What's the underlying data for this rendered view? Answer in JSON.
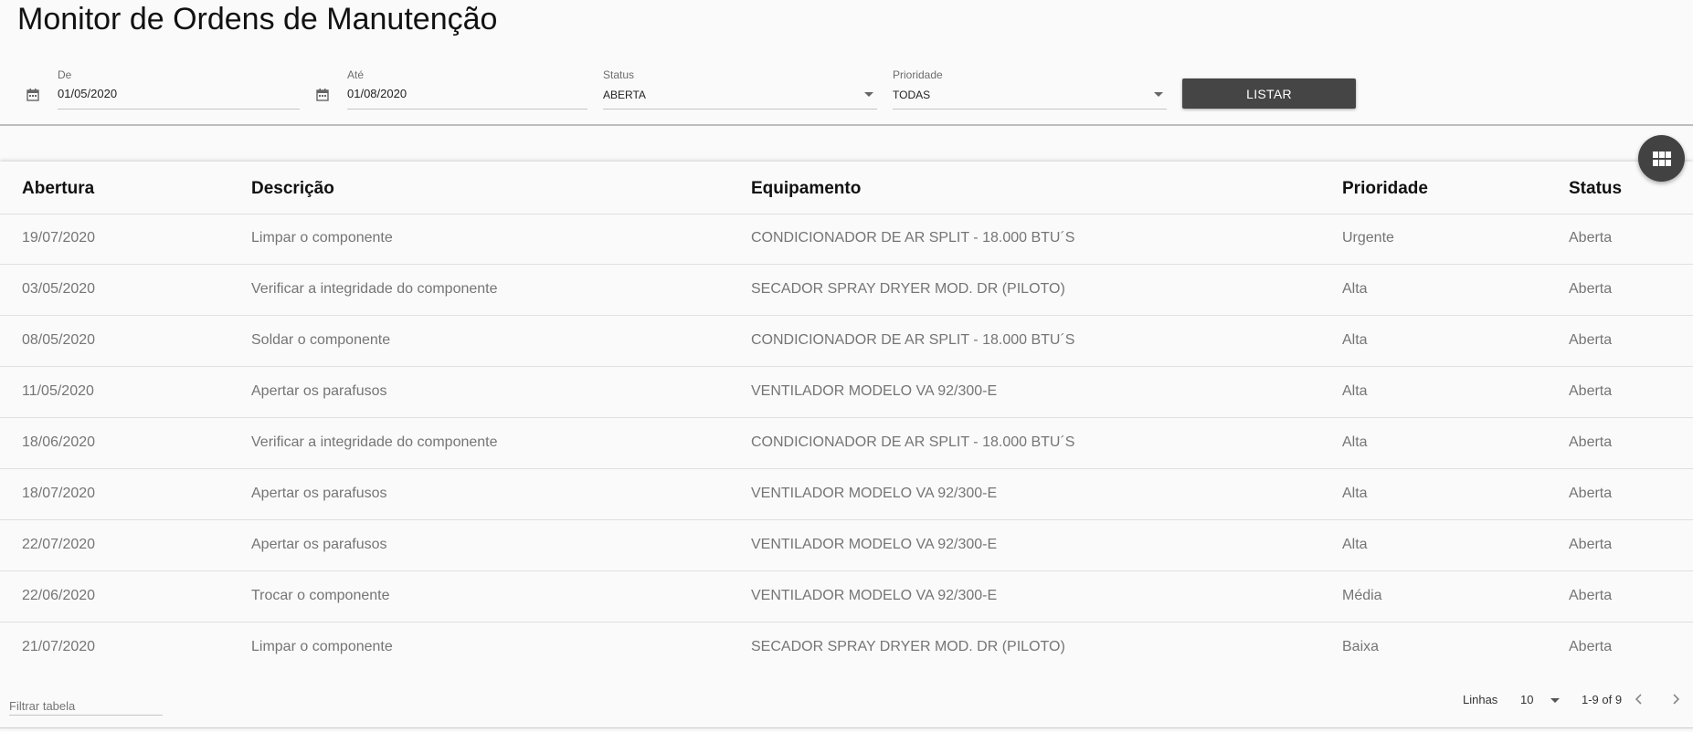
{
  "page": {
    "title": "Monitor de Ordens de Manutenção"
  },
  "filters": {
    "from": {
      "label": "De",
      "value": "01/05/2020",
      "icon": "calendar-icon"
    },
    "to": {
      "label": "Até",
      "value": "01/08/2020",
      "icon": "calendar-icon"
    },
    "status": {
      "label": "Status",
      "value": "ABERTA"
    },
    "priority": {
      "label": "Prioridade",
      "value": "TODAS"
    },
    "list_button": "LISTAR"
  },
  "fab": {
    "icon": "grid-view-icon"
  },
  "table": {
    "columns": [
      "Abertura",
      "Descrição",
      "Equipamento",
      "Prioridade",
      "Status"
    ],
    "rows": [
      [
        "19/07/2020",
        "Limpar o componente",
        "CONDICIONADOR DE AR SPLIT - 18.000 BTU´S",
        "Urgente",
        "Aberta"
      ],
      [
        "03/05/2020",
        "Verificar a integridade do componente",
        "SECADOR SPRAY DRYER MOD. DR (PILOTO)",
        "Alta",
        "Aberta"
      ],
      [
        "08/05/2020",
        "Soldar o componente",
        "CONDICIONADOR DE AR SPLIT - 18.000 BTU´S",
        "Alta",
        "Aberta"
      ],
      [
        "11/05/2020",
        "Apertar os parafusos",
        "VENTILADOR MODELO VA 92/300-E",
        "Alta",
        "Aberta"
      ],
      [
        "18/06/2020",
        "Verificar a integridade do componente",
        "CONDICIONADOR DE AR SPLIT - 18.000 BTU´S",
        "Alta",
        "Aberta"
      ],
      [
        "18/07/2020",
        "Apertar os parafusos",
        "VENTILADOR MODELO VA 92/300-E",
        "Alta",
        "Aberta"
      ],
      [
        "22/07/2020",
        "Apertar os parafusos",
        "VENTILADOR MODELO VA 92/300-E",
        "Alta",
        "Aberta"
      ],
      [
        "22/06/2020",
        "Trocar o componente",
        "VENTILADOR MODELO VA 92/300-E",
        "Média",
        "Aberta"
      ],
      [
        "21/07/2020",
        "Limpar o componente",
        "SECADOR SPRAY DRYER MOD. DR (PILOTO)",
        "Baixa",
        "Aberta"
      ]
    ],
    "filter_placeholder": "Filtrar tabela"
  },
  "pagination": {
    "rows_label": "Linhas",
    "rows_per_page": "10",
    "range": "1-9 of 9",
    "prev_icon": "chevron-left-icon",
    "next_icon": "chevron-right-icon"
  }
}
